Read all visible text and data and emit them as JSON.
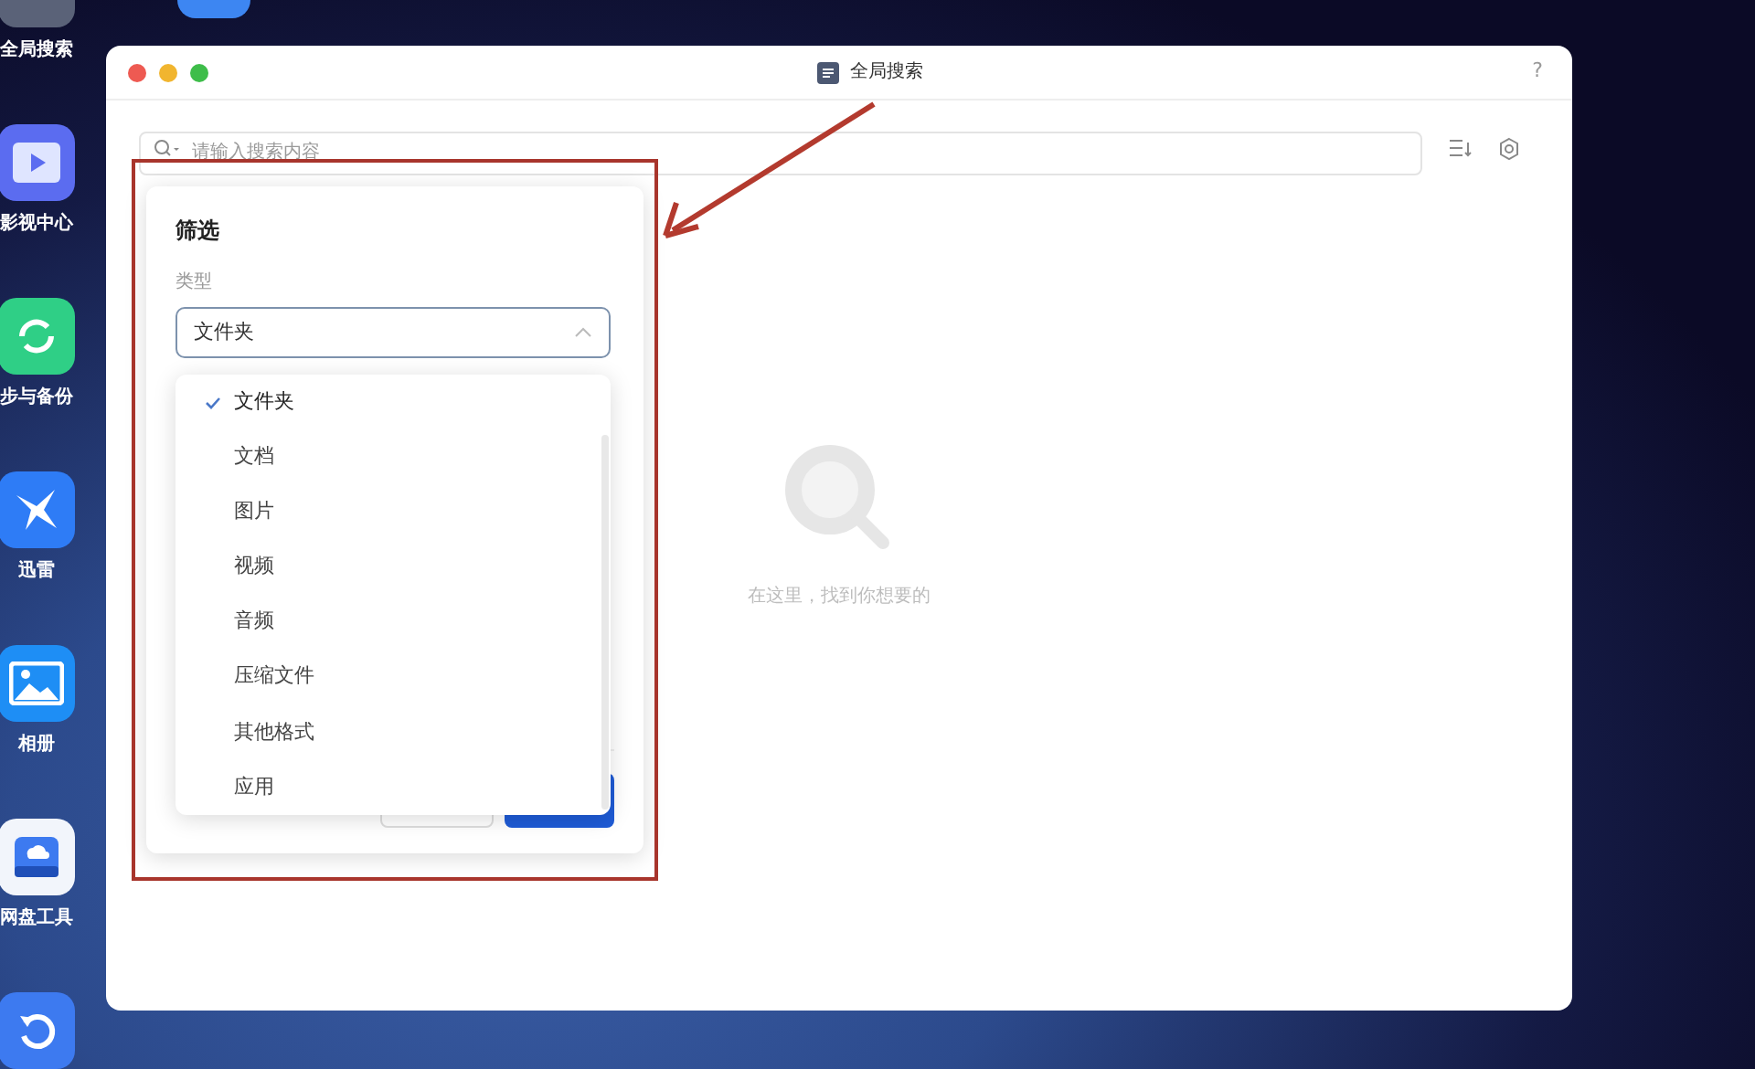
{
  "dock": [
    {
      "kind": "search",
      "label": "全局搜索"
    },
    {
      "kind": "video",
      "label": "影视中心"
    },
    {
      "kind": "sync",
      "label": "步与备份"
    },
    {
      "kind": "bird",
      "label": "迅雷"
    },
    {
      "kind": "photo",
      "label": "相册"
    },
    {
      "kind": "disk",
      "label": "网盘工具"
    },
    {
      "kind": "restore"
    }
  ],
  "window": {
    "title": "全局搜索",
    "help": "?",
    "search": {
      "placeholder": "请输入搜索内容"
    },
    "empty_state": {
      "text": "在这里，找到你想要的"
    },
    "filter": {
      "title": "筛选",
      "type_label": "类型",
      "type_value": "文件夹",
      "expanded": true,
      "options": [
        {
          "label": "文件夹",
          "selected": true
        },
        {
          "label": "文档",
          "selected": false
        },
        {
          "label": "图片",
          "selected": false
        },
        {
          "label": "视频",
          "selected": false
        },
        {
          "label": "音频",
          "selected": false
        },
        {
          "label": "压缩文件",
          "selected": false
        },
        {
          "label": "其他格式",
          "selected": false
        },
        {
          "label": "应用",
          "selected": false
        }
      ]
    }
  }
}
